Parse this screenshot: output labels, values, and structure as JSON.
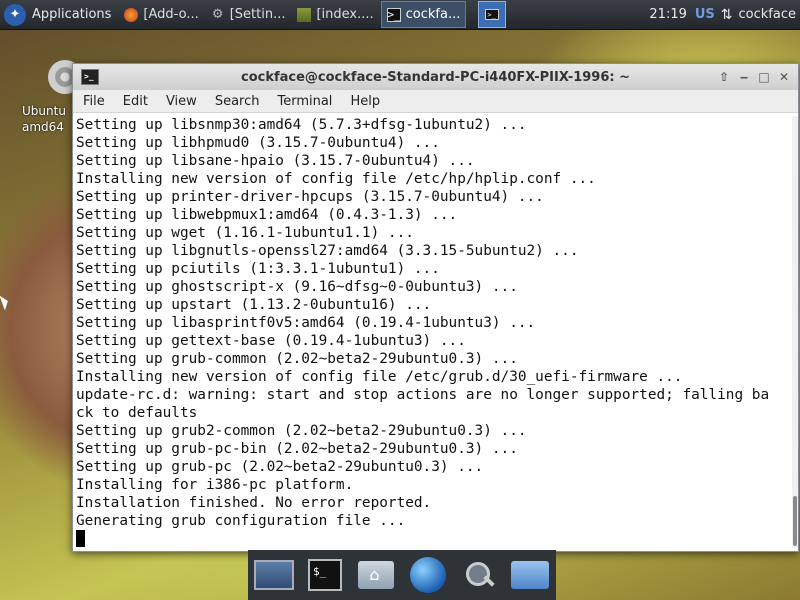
{
  "top_panel": {
    "applications_label": "Applications",
    "tasks": [
      {
        "label": "[Add-o...",
        "icon": "firefox-icon"
      },
      {
        "label": "[Settin...",
        "icon": "settings-gear-icon"
      },
      {
        "label": "[index....",
        "icon": "terminal-icon"
      },
      {
        "label": "cockfa...",
        "icon": "terminal-icon",
        "active": true
      }
    ],
    "clock": "21:19",
    "keyboard_layout": "US",
    "user": "cockface"
  },
  "desktop_icon": {
    "label_line1": "Ubuntu",
    "label_line2": "amd64"
  },
  "window": {
    "title": "cockface@cockface-Standard-PC-i440FX-PIIX-1996: ~",
    "menu": [
      "File",
      "Edit",
      "View",
      "Search",
      "Terminal",
      "Help"
    ]
  },
  "terminal": {
    "lines": [
      "Setting up libsnmp30:amd64 (5.7.3+dfsg-1ubuntu2) ...",
      "Setting up libhpmud0 (3.15.7-0ubuntu4) ...",
      "Setting up libsane-hpaio (3.15.7-0ubuntu4) ...",
      "Installing new version of config file /etc/hp/hplip.conf ...",
      "Setting up printer-driver-hpcups (3.15.7-0ubuntu4) ...",
      "Setting up libwebpmux1:amd64 (0.4.3-1.3) ...",
      "Setting up wget (1.16.1-1ubuntu1.1) ...",
      "Setting up libgnutls-openssl27:amd64 (3.3.15-5ubuntu2) ...",
      "Setting up pciutils (1:3.3.1-1ubuntu1) ...",
      "Setting up ghostscript-x (9.16~dfsg~0-0ubuntu3) ...",
      "Setting up upstart (1.13.2-0ubuntu16) ...",
      "Setting up libasprintf0v5:amd64 (0.19.4-1ubuntu3) ...",
      "Setting up gettext-base (0.19.4-1ubuntu3) ...",
      "Setting up grub-common (2.02~beta2-29ubuntu0.3) ...",
      "Installing new version of config file /etc/grub.d/30_uefi-firmware ...",
      "update-rc.d: warning: start and stop actions are no longer supported; falling ba",
      "ck to defaults",
      "Setting up grub2-common (2.02~beta2-29ubuntu0.3) ...",
      "Setting up grub-pc-bin (2.02~beta2-29ubuntu0.3) ...",
      "Setting up grub-pc (2.02~beta2-29ubuntu0.3) ...",
      "Installing for i386-pc platform.",
      "Installation finished. No error reported.",
      "Generating grub configuration file ..."
    ]
  },
  "dock": {
    "items": [
      "show-desktop-icon",
      "terminal-icon",
      "home-folder-icon",
      "web-browser-icon",
      "search-icon",
      "file-manager-icon"
    ]
  }
}
